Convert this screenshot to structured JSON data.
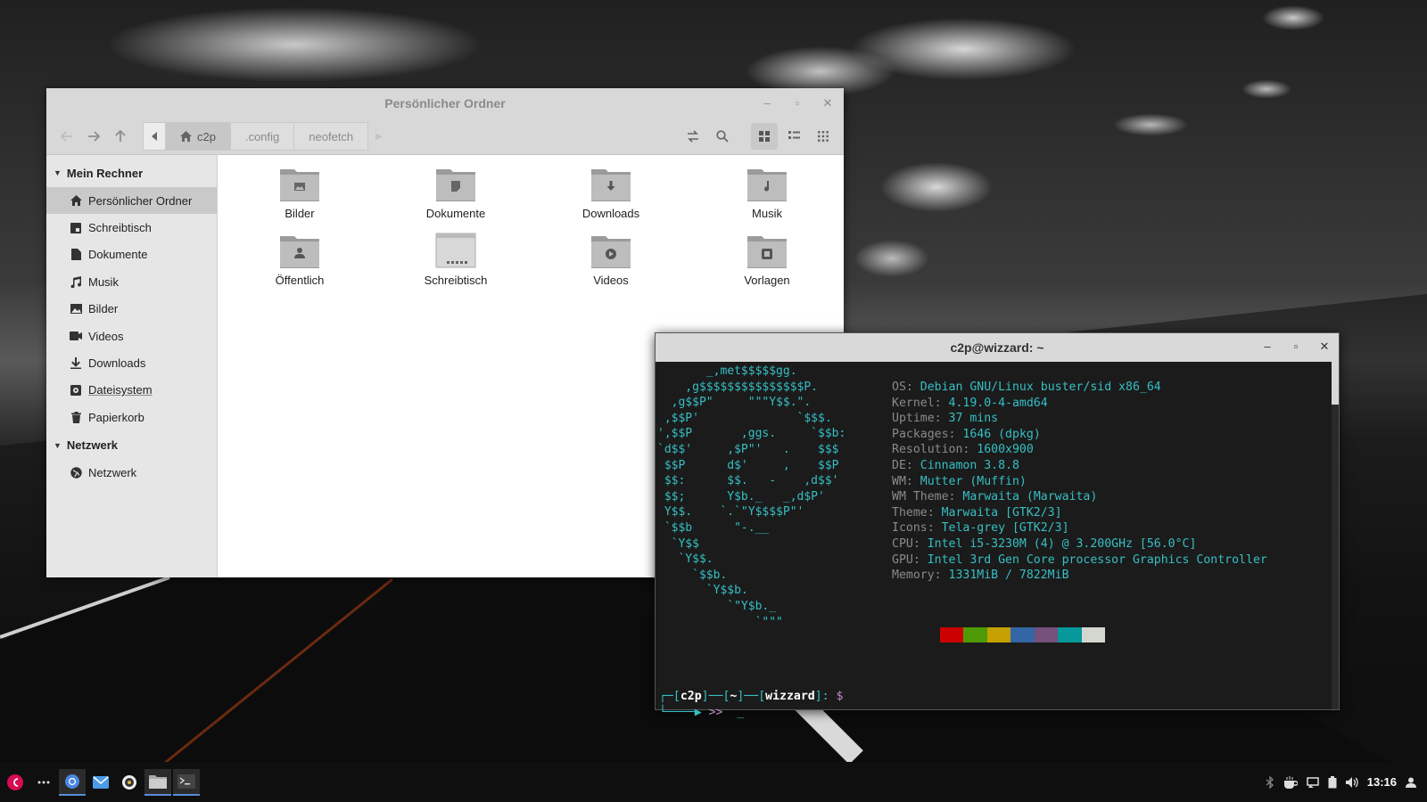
{
  "file_manager": {
    "title": "Persönlicher Ordner",
    "breadcrumbs": [
      "c2p",
      ".config",
      "neofetch"
    ],
    "sidebar": {
      "section1": "Mein Rechner",
      "items": [
        {
          "label": "Persönlicher Ordner",
          "icon": "home-icon",
          "selected": true
        },
        {
          "label": "Schreibtisch",
          "icon": "desktop-icon"
        },
        {
          "label": "Dokumente",
          "icon": "document-icon"
        },
        {
          "label": "Musik",
          "icon": "music-icon"
        },
        {
          "label": "Bilder",
          "icon": "image-icon"
        },
        {
          "label": "Videos",
          "icon": "video-icon"
        },
        {
          "label": "Downloads",
          "icon": "download-icon"
        },
        {
          "label": "Dateisystem",
          "icon": "drive-icon"
        },
        {
          "label": "Papierkorb",
          "icon": "trash-icon"
        }
      ],
      "section2": "Netzwerk",
      "network_items": [
        {
          "label": "Netzwerk",
          "icon": "network-icon"
        }
      ]
    },
    "folders": [
      {
        "label": "Bilder",
        "icon": "image-folder-icon"
      },
      {
        "label": "Dokumente",
        "icon": "document-folder-icon"
      },
      {
        "label": "Downloads",
        "icon": "download-folder-icon"
      },
      {
        "label": "Musik",
        "icon": "music-folder-icon"
      },
      {
        "label": "Öffentlich",
        "icon": "public-folder-icon"
      },
      {
        "label": "Schreibtisch",
        "icon": "desktop-folder-icon"
      },
      {
        "label": "Videos",
        "icon": "video-folder-icon"
      },
      {
        "label": "Vorlagen",
        "icon": "templates-folder-icon"
      }
    ]
  },
  "terminal": {
    "title": "c2p@wizzard: ~",
    "ascii_logo": "       _,met$$$$$gg.\n    ,g$$$$$$$$$$$$$$$P.\n  ,g$$P\"     \"\"\"Y$$.\".\n ,$$P'              `$$$.\n',$$P       ,ggs.     `$$b:\n`d$$'     ,$P\"'   .    $$$\n $$P      d$'     ,    $$P\n $$:      $$.   -    ,d$$'\n $$;      Y$b._   _,d$P'\n Y$$.    `.`\"Y$$$$P\"'\n `$$b      \"-.__\n  `Y$$\n   `Y$$.\n     `$$b.\n       `Y$$b.\n          `\"Y$b._\n              `\"\"\"",
    "info": [
      {
        "key": "OS",
        "value": "Debian GNU/Linux buster/sid x86_64"
      },
      {
        "key": "Kernel",
        "value": "4.19.0-4-amd64"
      },
      {
        "key": "Uptime",
        "value": "37 mins"
      },
      {
        "key": "Packages",
        "value": "1646 (dpkg)"
      },
      {
        "key": "Resolution",
        "value": "1600x900"
      },
      {
        "key": "DE",
        "value": "Cinnamon 3.8.8"
      },
      {
        "key": "WM",
        "value": "Mutter (Muffin)"
      },
      {
        "key": "WM Theme",
        "value": "Marwaita (Marwaita)"
      },
      {
        "key": "Theme",
        "value": "Marwaita [GTK2/3]"
      },
      {
        "key": "Icons",
        "value": "Tela-grey [GTK2/3]"
      },
      {
        "key": "CPU",
        "value": "Intel i5-3230M (4) @ 3.200GHz [56.0°C]"
      },
      {
        "key": "GPU",
        "value": "Intel 3rd Gen Core processor Graphics Controller"
      },
      {
        "key": "Memory",
        "value": "1331MiB / 7822MiB"
      }
    ],
    "palette": [
      "#1b1b1b",
      "#cc0000",
      "#4e9a06",
      "#c4a000",
      "#3465a4",
      "#75507b",
      "#06989a",
      "#d3d7cf"
    ],
    "prompt": {
      "user": "c2p",
      "dir": "~",
      "host": "wizzard",
      "symbol": "$",
      "cont": ">>",
      "cursor": "_"
    }
  },
  "taskbar": {
    "clock": "13:16"
  }
}
